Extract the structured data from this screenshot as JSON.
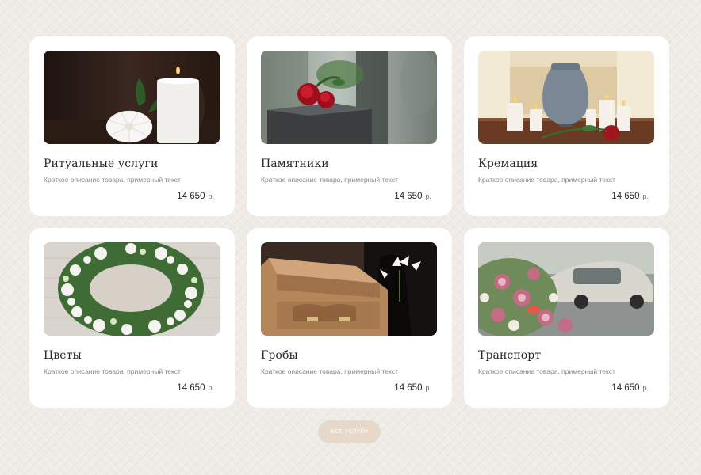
{
  "cards": [
    {
      "title": "Ритуальные услуги",
      "desc": "Краткое описание товара, примерный текст",
      "price": "14 650",
      "currency": "р.",
      "image_icon": "candle-flower-photo"
    },
    {
      "title": "Памятники",
      "desc": "Краткое описание товара, примерный текст",
      "price": "14 650",
      "currency": "р.",
      "image_icon": "monument-rose-photo"
    },
    {
      "title": "Кремация",
      "desc": "Краткое описание товара, примерный текст",
      "price": "14 650",
      "currency": "р.",
      "image_icon": "urn-candles-photo"
    },
    {
      "title": "Цветы",
      "desc": "Краткое описание товара, примерный текст",
      "price": "14 650",
      "currency": "р.",
      "image_icon": "flower-wreath-photo"
    },
    {
      "title": "Гробы",
      "desc": "Краткое описание товара, примерный текст",
      "price": "14 650",
      "currency": "р.",
      "image_icon": "coffin-lilies-photo"
    },
    {
      "title": "Транспорт",
      "desc": "Краткое описание товара, примерный текст",
      "price": "14 650",
      "currency": "р.",
      "image_icon": "hearse-flowers-photo"
    }
  ],
  "all_services_button": "ВСЕ УСЛУГИ",
  "colors": {
    "background": "#efebe7",
    "card": "#ffffff",
    "button": "#e6d9c9",
    "text": "#2a2623",
    "muted": "#8c8580"
  }
}
